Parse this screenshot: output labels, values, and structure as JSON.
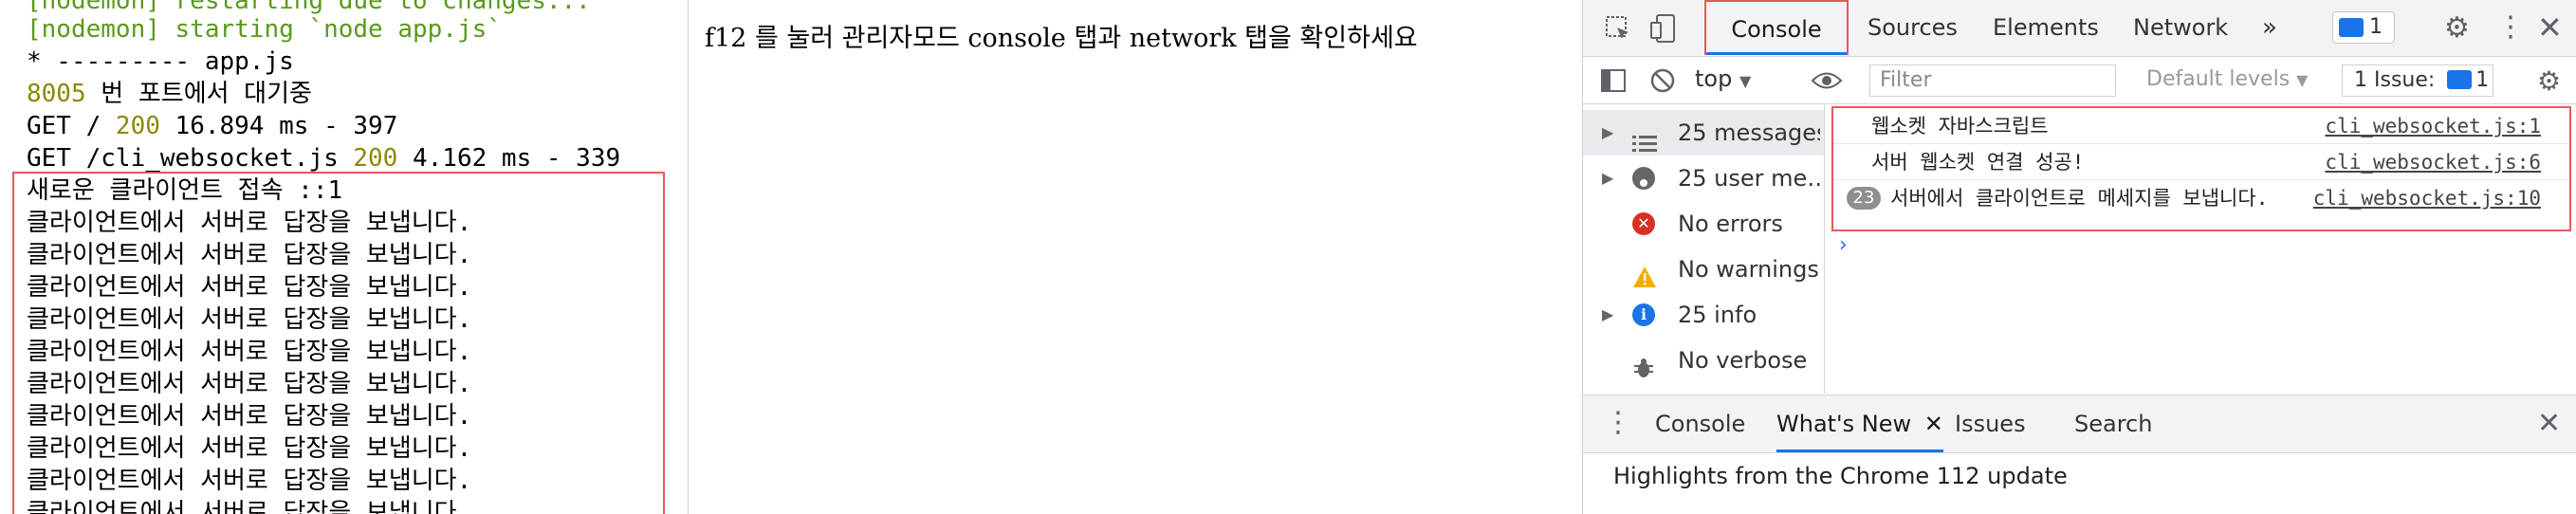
{
  "terminal": {
    "lines": [
      "[nodemon] restarting due to changes...",
      "[nodemon] starting `node app.js`",
      "* --------- app.js",
      "8005 번 포트에서 대기중",
      "GET / 200 16.894 ms - 397",
      "GET /cli_websocket.js 200 4.162 ms - 339",
      "새로운 클라이언트 접속 ::1",
      "클라이언트에서 서버로 답장을 보냅니다.",
      "클라이언트에서 서버로 답장을 보냅니다.",
      "클라이언트에서 서버로 답장을 보냅니다.",
      "클라이언트에서 서버로 답장을 보냅니다.",
      "클라이언트에서 서버로 답장을 보냅니다.",
      "클라이언트에서 서버로 답장을 보냅니다.",
      "클라이언트에서 서버로 답장을 보냅니다.",
      "클라이언트에서 서버로 답장을 보냅니다.",
      "클라이언트에서 서버로 답장을 보냅니다.",
      "클라이언트에서 서버로 답장을 보냅니다."
    ],
    "colors": {
      "nodemon": "#5a9a1a",
      "number": "#8a8a00",
      "highlight_box": "#e45a5a"
    }
  },
  "page": {
    "text": "f12 를 눌러 관리자모드 console 탭과 network 탭을 확인하세요"
  },
  "devtools": {
    "tabs": [
      "Console",
      "Sources",
      "Elements",
      "Network"
    ],
    "active_tab": "Console",
    "more_tabs": "»",
    "message_badge_count": "1",
    "context": "top",
    "filter_placeholder": "Filter",
    "levels": "Default levels",
    "issues_label": "1 Issue:",
    "issues_count": "1",
    "sidebar": [
      {
        "label": "25 messages",
        "icon": "list-icon",
        "expandable": true
      },
      {
        "label": "25 user me…",
        "icon": "user-icon",
        "expandable": true
      },
      {
        "label": "No errors",
        "icon": "error-icon",
        "expandable": false
      },
      {
        "label": "No warnings",
        "icon": "warning-icon",
        "expandable": false
      },
      {
        "label": "25 info",
        "icon": "info-icon",
        "expandable": true
      },
      {
        "label": "No verbose",
        "icon": "verbose-icon",
        "expandable": false
      }
    ],
    "messages": [
      {
        "text": "웹소켓 자바스크립트",
        "source": "cli_websocket.js:1",
        "count": ""
      },
      {
        "text": "서버 웹소켓 연결 성공!",
        "source": "cli_websocket.js:6",
        "count": ""
      },
      {
        "text": "서버에서 클라이언트로 메세지를 보냅니다.",
        "source": "cli_websocket.js:10",
        "count": "23"
      }
    ],
    "prompt": "›",
    "drawer_tabs": [
      "Console",
      "What's New",
      "Issues",
      "Search"
    ],
    "drawer_active": "What's New",
    "drawer_content": "Highlights from the Chrome 112 update",
    "accent": "#1a73e8"
  }
}
